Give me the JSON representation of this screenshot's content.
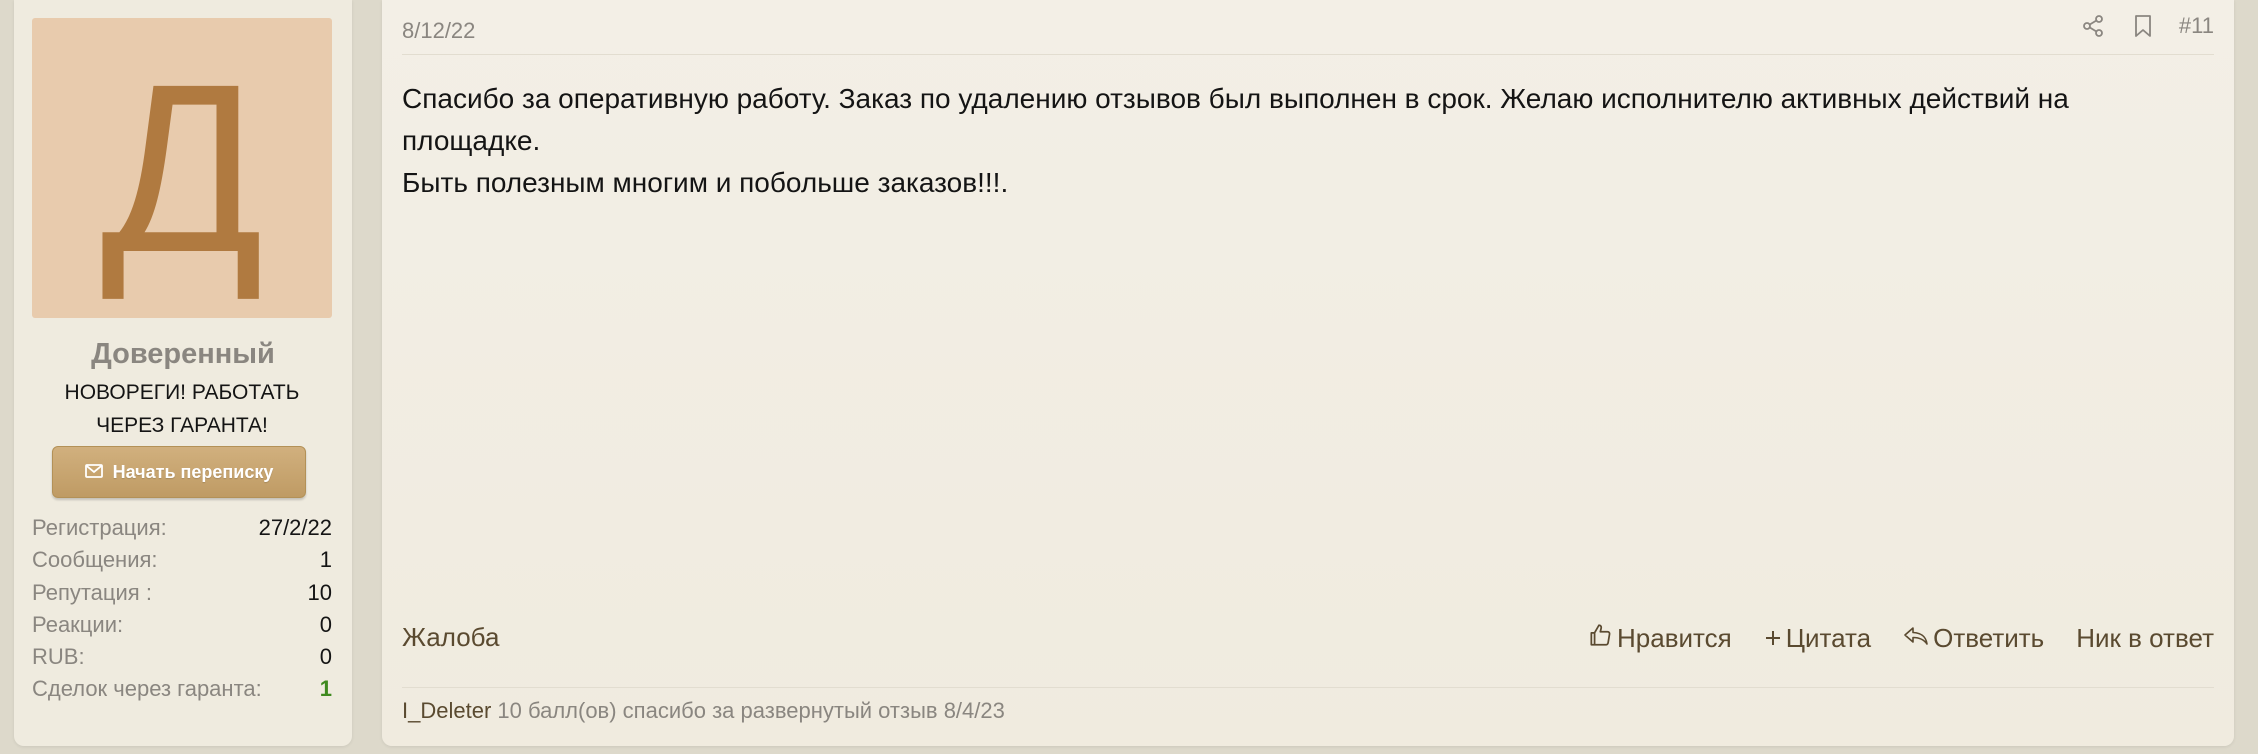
{
  "user": {
    "avatar_letter": "Д",
    "avatar_bg": "#e8cbad",
    "avatar_fg": "#b07a40",
    "name": "Доверенный",
    "title": "НОВОРЕГИ! РАБОТАТЬ\nЧЕРЕЗ ГАРАНТА!",
    "start_conversation_label": "Начать переписку",
    "stats": [
      {
        "label": "Регистрация:",
        "value": "27/2/22"
      },
      {
        "label": "Сообщения:",
        "value": "1"
      },
      {
        "label": "Репутация :",
        "value": "10"
      },
      {
        "label": "Реакции:",
        "value": "0"
      },
      {
        "label": "RUB:",
        "value": "0"
      },
      {
        "label": "Сделок через гаранта:",
        "value": "1"
      }
    ]
  },
  "post": {
    "date": "8/12/22",
    "number": "#11",
    "body_lines": [
      "Спасибо за оперативную работу. Заказ по удалению отзывов был выполнен в срок. Желаю исполнителю активных действий на площадке.",
      "Быть полезным многим и побольше заказов!!!."
    ],
    "report_label": "Жалоба",
    "actions": {
      "like": "Нравится",
      "quote": "Цитата",
      "reply": "Ответить",
      "nick": "Ник в ответ"
    },
    "reaction": {
      "user": "I_Deleter",
      "text": "10 балл(ов) спасибо за развернутый отзыв 8/4/23"
    }
  },
  "colors": {
    "page_bg": "#ddd9cb",
    "panel_bg": "#efebdf",
    "button": "#c9a670",
    "link": "#5a4a30",
    "muted": "#8a8680",
    "positive": "#3f8a1f"
  }
}
